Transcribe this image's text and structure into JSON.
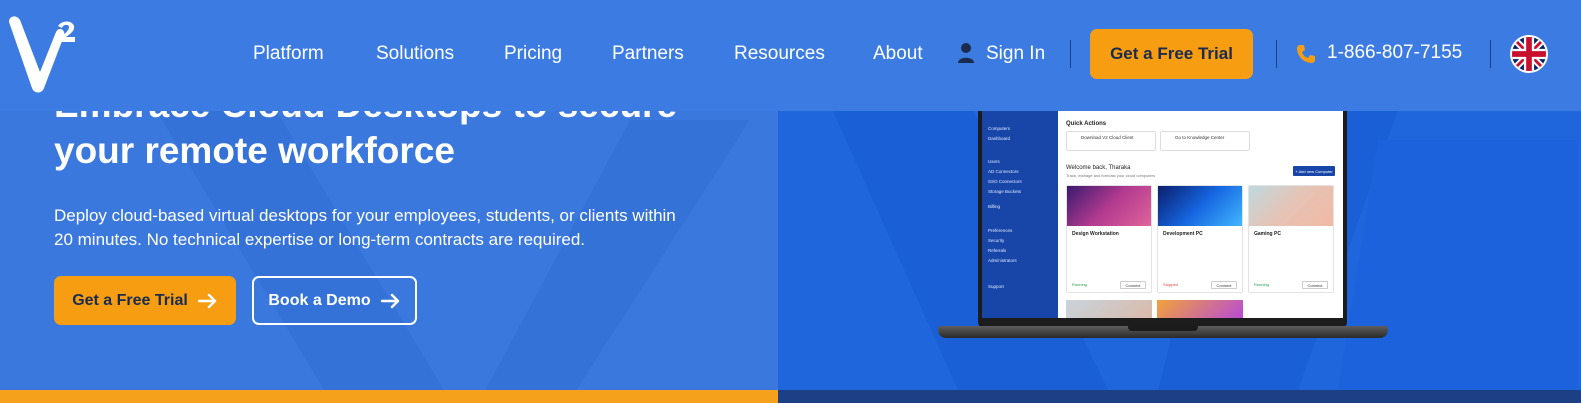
{
  "brand": {
    "logo_icon": "v2-cloud-logo"
  },
  "nav": {
    "items": [
      "Platform",
      "Solutions",
      "Pricing",
      "Partners",
      "Resources",
      "About"
    ],
    "sign_in": "Sign In",
    "trial_button": "Get a Free Trial",
    "phone": "1-866-807-7155",
    "language_icon": "uk-flag-icon"
  },
  "hero": {
    "title_line1": "Embrace Cloud Desktops to secure",
    "title_line2": "your remote workforce",
    "subtitle_line1": "Deploy cloud-based virtual desktops for your employees, students, or clients within",
    "subtitle_line2": "20 minutes. No technical expertise or long-term contracts are required.",
    "cta_trial": "Get a Free Trial",
    "cta_demo": "Book a Demo"
  },
  "app_preview": {
    "sidebar": [
      "Computers",
      "Dashboard",
      "Users",
      "AD Connectors",
      "SSO Connectors",
      "Storage Buckets",
      "Billing",
      "Preferences",
      "Security",
      "Referrals",
      "Administrators",
      "Support"
    ],
    "quick_actions_title": "Quick Actions",
    "quick_actions": [
      "Download V2 Cloud Client",
      "Go to Knowledge Center"
    ],
    "welcome": "Welcome back, Tharaka",
    "welcome_sub": "Track, manage and forecast your cloud computers",
    "add_button": "+ Add new Computer",
    "computers": [
      {
        "name": "Design Workstation",
        "status": "Running",
        "status_color": "#1e9e4a",
        "action": "Connect"
      },
      {
        "name": "Development PC",
        "status": "Stopped",
        "status_color": "#e0453a",
        "action": "Connect"
      },
      {
        "name": "Gaming PC",
        "status": "Running",
        "status_color": "#1e9e4a",
        "action": "Connect"
      }
    ]
  },
  "colors": {
    "hero_blue": "#3a78de",
    "accent_orange": "#f69d12",
    "dark_navy": "#1b2b4d"
  }
}
